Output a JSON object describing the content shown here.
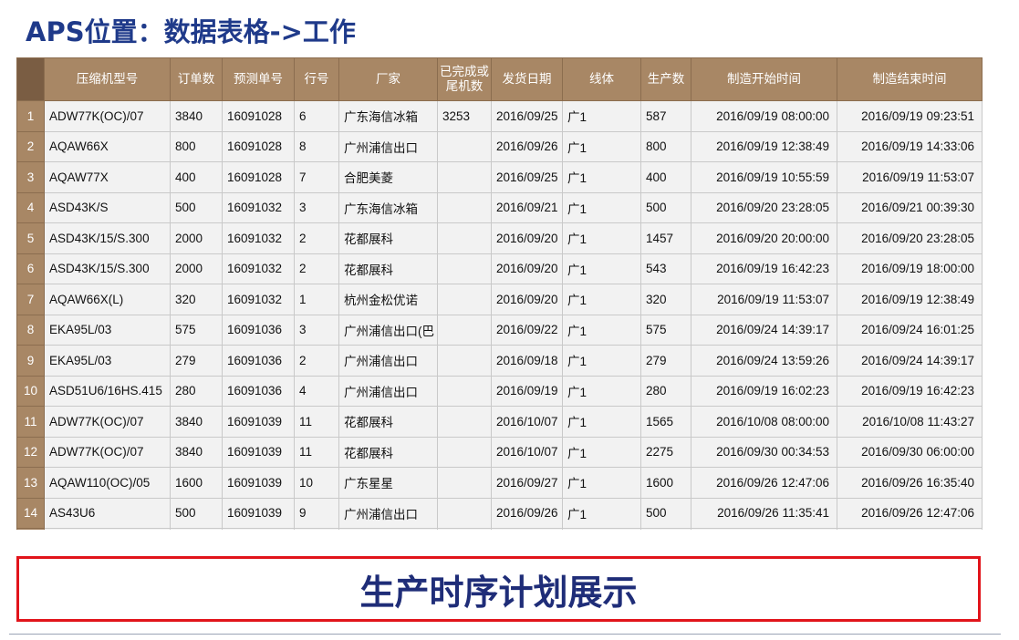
{
  "slide": {
    "title": "APS位置：数据表格->工作",
    "caption": "生产时序计划展示"
  },
  "table": {
    "headers": [
      "压缩机型号",
      "订单数",
      "预测单号",
      "行号",
      "厂家",
      "已完成或\n尾机数",
      "发货日期",
      "线体",
      "生产数",
      "制造开始时间",
      "制造结束时间"
    ],
    "rows": [
      {
        "n": "1",
        "model": "ADW77K(OC)/07",
        "orders": "3840",
        "forecast": "16091028",
        "line_no": "6",
        "vendor": "广东海信冰箱",
        "done": "3253",
        "ship": "2016/09/25",
        "line": "广1",
        "qty": "587",
        "start": "2016/09/19 08:00:00",
        "end": "2016/09/19 09:23:51"
      },
      {
        "n": "2",
        "model": "AQAW66X",
        "orders": "800",
        "forecast": "16091028",
        "line_no": "8",
        "vendor": "广州浦信出口",
        "done": "",
        "ship": "2016/09/26",
        "line": "广1",
        "qty": "800",
        "start": "2016/09/19 12:38:49",
        "end": "2016/09/19 14:33:06"
      },
      {
        "n": "3",
        "model": "AQAW77X",
        "orders": "400",
        "forecast": "16091028",
        "line_no": "7",
        "vendor": "合肥美菱",
        "done": "",
        "ship": "2016/09/25",
        "line": "广1",
        "qty": "400",
        "start": "2016/09/19 10:55:59",
        "end": "2016/09/19 11:53:07"
      },
      {
        "n": "4",
        "model": "ASD43K/S",
        "orders": "500",
        "forecast": "16091032",
        "line_no": "3",
        "vendor": "广东海信冰箱",
        "done": "",
        "ship": "2016/09/21",
        "line": "广1",
        "qty": "500",
        "start": "2016/09/20 23:28:05",
        "end": "2016/09/21 00:39:30"
      },
      {
        "n": "5",
        "model": "ASD43K/15/S.300",
        "orders": "2000",
        "forecast": "16091032",
        "line_no": "2",
        "vendor": "花都展科",
        "done": "",
        "ship": "2016/09/20",
        "line": "广1",
        "qty": "1457",
        "start": "2016/09/20 20:00:00",
        "end": "2016/09/20 23:28:05"
      },
      {
        "n": "6",
        "model": "ASD43K/15/S.300",
        "orders": "2000",
        "forecast": "16091032",
        "line_no": "2",
        "vendor": "花都展科",
        "done": "",
        "ship": "2016/09/20",
        "line": "广1",
        "qty": "543",
        "start": "2016/09/19 16:42:23",
        "end": "2016/09/19 18:00:00"
      },
      {
        "n": "7",
        "model": "AQAW66X(L)",
        "orders": "320",
        "forecast": "16091032",
        "line_no": "1",
        "vendor": "杭州金松优诺",
        "done": "",
        "ship": "2016/09/20",
        "line": "广1",
        "qty": "320",
        "start": "2016/09/19 11:53:07",
        "end": "2016/09/19 12:38:49"
      },
      {
        "n": "8",
        "model": "EKA95L/03",
        "orders": "575",
        "forecast": "16091036",
        "line_no": "3",
        "vendor": "广州浦信出口(巴",
        "done": "",
        "ship": "2016/09/22",
        "line": "广1",
        "qty": "575",
        "start": "2016/09/24 14:39:17",
        "end": "2016/09/24 16:01:25"
      },
      {
        "n": "9",
        "model": "EKA95L/03",
        "orders": "279",
        "forecast": "16091036",
        "line_no": "2",
        "vendor": "广州浦信出口",
        "done": "",
        "ship": "2016/09/18",
        "line": "广1",
        "qty": "279",
        "start": "2016/09/24 13:59:26",
        "end": "2016/09/24 14:39:17"
      },
      {
        "n": "10",
        "model": "ASD51U6/16HS.415",
        "orders": "280",
        "forecast": "16091036",
        "line_no": "4",
        "vendor": "广州浦信出口",
        "done": "",
        "ship": "2016/09/19",
        "line": "广1",
        "qty": "280",
        "start": "2016/09/19 16:02:23",
        "end": "2016/09/19 16:42:23"
      },
      {
        "n": "11",
        "model": "ADW77K(OC)/07",
        "orders": "3840",
        "forecast": "16091039",
        "line_no": "11",
        "vendor": "花都展科",
        "done": "",
        "ship": "2016/10/07",
        "line": "广1",
        "qty": "1565",
        "start": "2016/10/08 08:00:00",
        "end": "2016/10/08 11:43:27"
      },
      {
        "n": "12",
        "model": "ADW77K(OC)/07",
        "orders": "3840",
        "forecast": "16091039",
        "line_no": "11",
        "vendor": "花都展科",
        "done": "",
        "ship": "2016/10/07",
        "line": "广1",
        "qty": "2275",
        "start": "2016/09/30 00:34:53",
        "end": "2016/09/30 06:00:00"
      },
      {
        "n": "13",
        "model": "AQAW110(OC)/05",
        "orders": "1600",
        "forecast": "16091039",
        "line_no": "10",
        "vendor": "广东星星",
        "done": "",
        "ship": "2016/09/27",
        "line": "广1",
        "qty": "1600",
        "start": "2016/09/26 12:47:06",
        "end": "2016/09/26 16:35:40"
      },
      {
        "n": "14",
        "model": "AS43U6",
        "orders": "500",
        "forecast": "16091039",
        "line_no": "9",
        "vendor": "广州浦信出口",
        "done": "",
        "ship": "2016/09/26",
        "line": "广1",
        "qty": "500",
        "start": "2016/09/26 11:35:41",
        "end": "2016/09/26 12:47:06"
      },
      {
        "n": "",
        "model": "",
        "orders": "",
        "forecast": "",
        "line_no": "",
        "vendor": "",
        "done": "",
        "ship": "",
        "line": "",
        "qty": "",
        "start": "",
        "end": ""
      }
    ]
  },
  "colors": {
    "header_bg": "#a88765",
    "title_color": "#1f3a8a",
    "box_border": "#e1141b",
    "caption_color": "#1f2d78"
  }
}
